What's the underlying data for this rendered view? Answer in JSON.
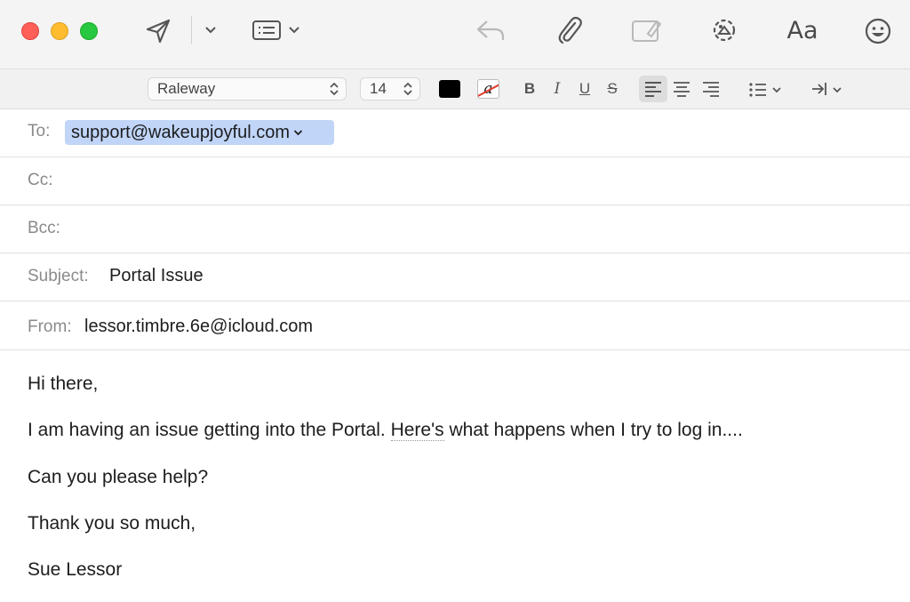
{
  "format": {
    "font": "Raleway",
    "size": "14",
    "bold": "B",
    "italic": "I",
    "underline": "U",
    "strike": "S"
  },
  "toolbar": {
    "font_button": "Aa"
  },
  "colors": {
    "text_color": "#000000",
    "token_bg": "#c0d5f7"
  },
  "header": {
    "to_label": "To:",
    "to_value": "support@wakeupjoyful.com",
    "cc_label": "Cc:",
    "bcc_label": "Bcc:",
    "subject_label": "Subject:",
    "subject_value": "Portal Issue",
    "from_label": "From:",
    "from_value": "lessor.timbre.6e@icloud.com"
  },
  "body": {
    "greeting": "Hi there,",
    "line1_before": "I am having an issue getting into the Portal. ",
    "line1_flagged": "Here's",
    "line1_after": " what happens when I try to log in....",
    "line2": "Can you please help?",
    "line3": "Thank you so much,",
    "signature": "Sue Lessor"
  }
}
